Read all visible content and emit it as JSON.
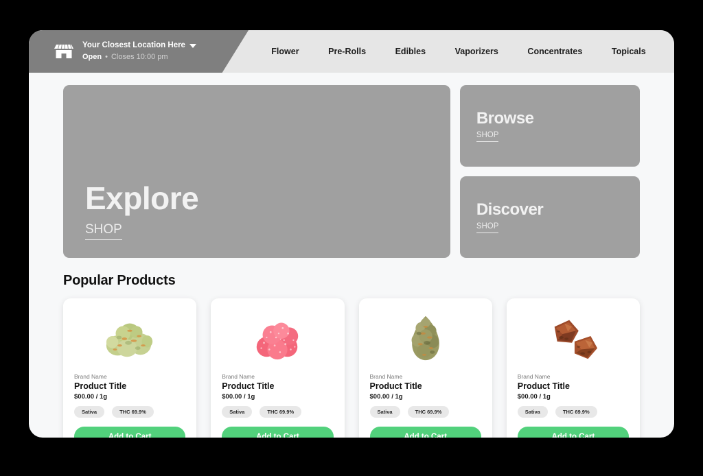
{
  "theme": {
    "accent_green": "#52d17c",
    "panel_gray": "#a0a0a0",
    "location_gray": "#7f7f7f",
    "nav_bar_gray": "#e6e6e6",
    "page_bg": "#f7f8f9",
    "outer_bg": "#000000"
  },
  "header": {
    "store_icon": "storefront-icon",
    "location_name": "Your Closest Location Here",
    "dropdown_icon": "chevron-down-icon",
    "open_status": "Open",
    "separator": "•",
    "hours": "Closes 10:00 pm",
    "nav": [
      {
        "label": "Flower"
      },
      {
        "label": "Pre-Rolls"
      },
      {
        "label": "Edibles"
      },
      {
        "label": "Vaporizers"
      },
      {
        "label": "Concentrates"
      },
      {
        "label": "Topicals"
      }
    ]
  },
  "hero": {
    "explore": {
      "title": "Explore",
      "cta": "SHOP"
    },
    "browse": {
      "title": "Browse",
      "cta": "SHOP"
    },
    "discover": {
      "title": "Discover",
      "cta": "SHOP"
    }
  },
  "popular": {
    "section_title": "Popular Products",
    "products": [
      {
        "image": "cannabis-buds-light-green-image",
        "brand": "Brand Name",
        "title": "Product Title",
        "price": "$00.00 / 1g",
        "strain_tag": "Sativa",
        "thc_tag": "THC 69.9%",
        "button": "Add to Cart"
      },
      {
        "image": "pink-gummies-image",
        "brand": "Brand Name",
        "title": "Product Title",
        "price": "$00.00 / 1g",
        "strain_tag": "Sativa",
        "thc_tag": "THC 69.9%",
        "button": "Add to Cart"
      },
      {
        "image": "cannabis-bud-olive-image",
        "brand": "Brand Name",
        "title": "Product Title",
        "price": "$00.00 / 1g",
        "strain_tag": "Sativa",
        "thc_tag": "THC 69.9%",
        "button": "Add to Cart"
      },
      {
        "image": "hash-concentrate-chunks-image",
        "brand": "Brand Name",
        "title": "Product Title",
        "price": "$00.00 / 1g",
        "strain_tag": "Sativa",
        "thc_tag": "THC 69.9%",
        "button": "Add to Cart"
      }
    ]
  }
}
